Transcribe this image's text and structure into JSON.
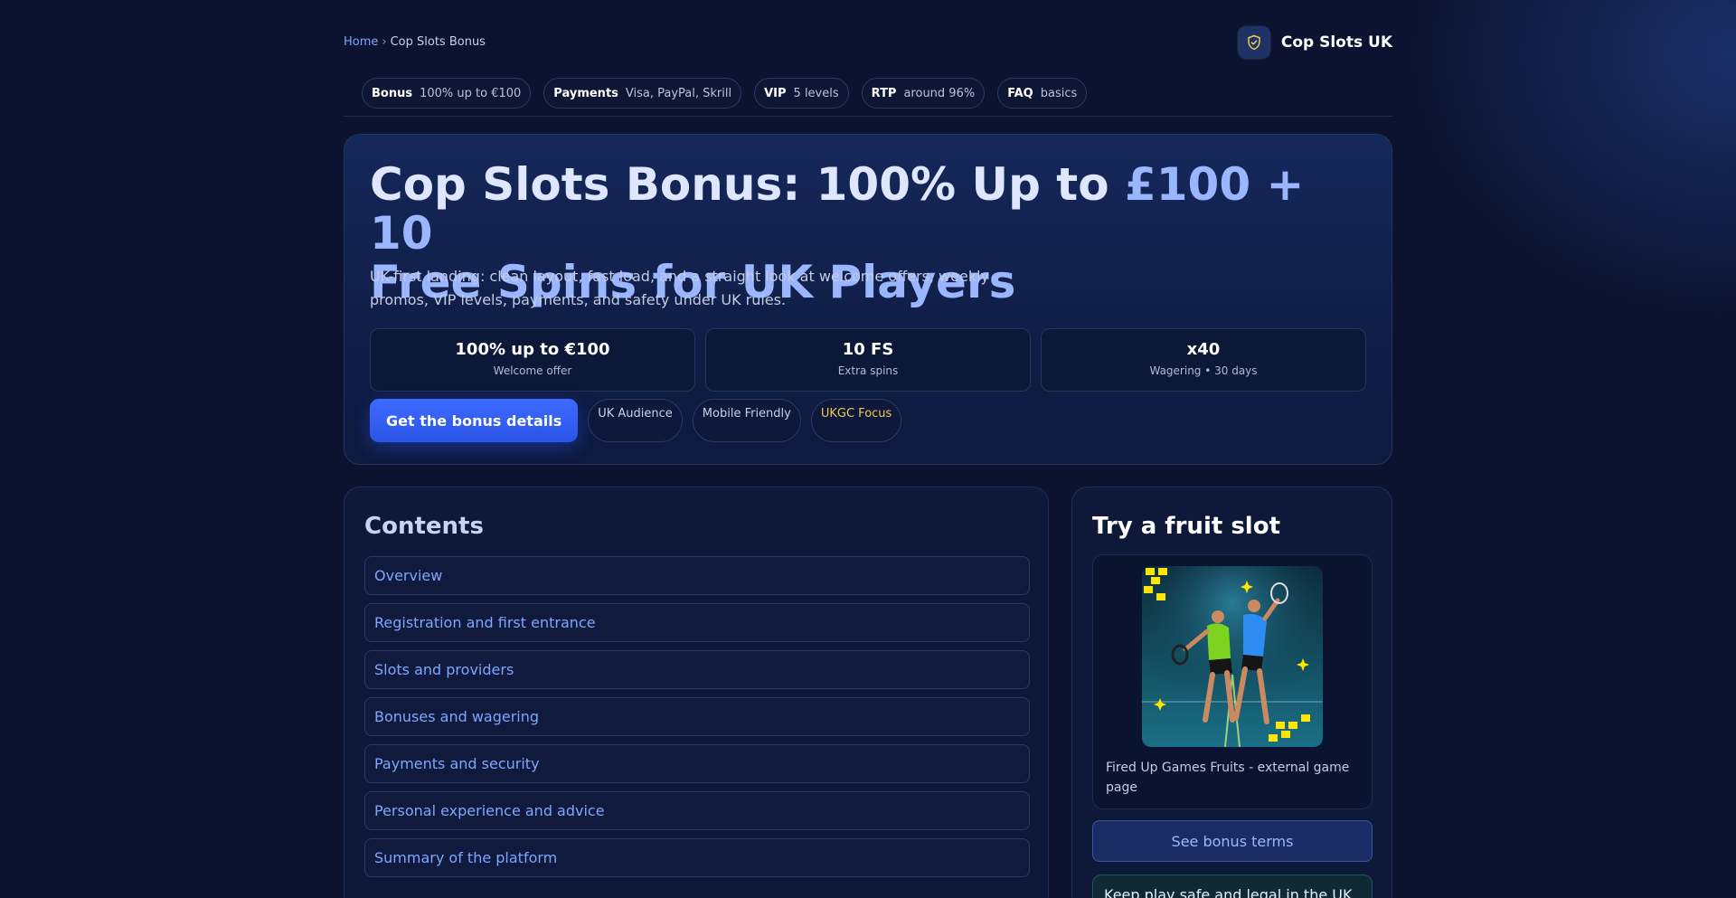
{
  "breadcrumb": {
    "home": "Home",
    "separator": "›",
    "current": "Cop Slots Bonus"
  },
  "brand": {
    "name": "Cop Slots UK",
    "icon": "shield-check-icon"
  },
  "chips": [
    {
      "key": "Bonus",
      "value": "100% up to €100"
    },
    {
      "key": "Payments",
      "value": "Visa, PayPal, Skrill"
    },
    {
      "key": "VIP",
      "value": "5 levels"
    },
    {
      "key": "RTP",
      "value": "around 96%"
    },
    {
      "key": "FAQ",
      "value": "basics"
    }
  ],
  "hero": {
    "title_part1": "Cop Slots Bonus: 100% Up to ",
    "title_accent": "£100 + 10",
    "title_part2": "Free Spins for UK Players",
    "lead": "UK-first landing: clean layout, fast load, and a straight look at welcome offers, weekly promos, VIP levels, payments, and safety under UK rules.",
    "stats": [
      {
        "value": "100% up to €100",
        "label": "Welcome offer"
      },
      {
        "value": "10 FS",
        "label": "Extra spins"
      },
      {
        "value": "x40",
        "label": "Wagering • 30 days"
      }
    ],
    "cta_label": "Get the bonus details",
    "tags": [
      "UK Audience",
      "Mobile Friendly",
      "UKGC Focus"
    ]
  },
  "contents": {
    "title": "Contents",
    "items": [
      "Overview",
      "Registration and first entrance",
      "Slots and providers",
      "Bonuses and wagering",
      "Payments and security",
      "Personal experience and advice",
      "Summary of the platform"
    ]
  },
  "side": {
    "title": "Try a fruit slot",
    "game_caption": "Fired Up Games Fruits - external game page",
    "terms_label": "See bonus terms",
    "safe_note": "Keep play safe and legal in the UK"
  },
  "colors": {
    "accent": "#3d6bff",
    "link": "#7ea6ff",
    "gold": "#f2c94c",
    "background": "#0b1330"
  }
}
